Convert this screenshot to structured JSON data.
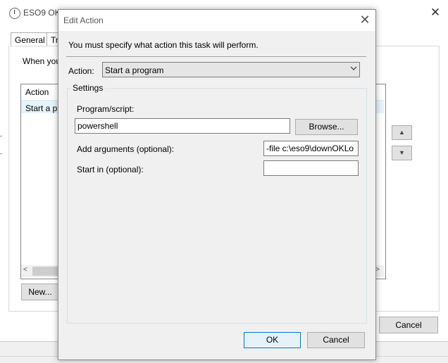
{
  "background_window": {
    "title": "ESO9 OK",
    "tabs": [
      "General",
      "Tr"
    ],
    "when_text": "When you",
    "list": {
      "header": "Action",
      "rows": [
        "Start a pr"
      ]
    },
    "buttons": {
      "new": "New...",
      "cancel": "Cancel"
    }
  },
  "dialog": {
    "title": "Edit Action",
    "instruction": "You must specify what action this task will perform.",
    "action_label": "Action:",
    "action_value": "Start a program",
    "settings_label": "Settings",
    "program_label": "Program/script:",
    "program_value": "powershell",
    "browse_label": "Browse...",
    "args_label": "Add arguments (optional):",
    "args_value": "-file c:\\eso9\\downOKLo",
    "startin_label": "Start in (optional):",
    "startin_value": "",
    "ok_label": "OK",
    "cancel_label": "Cancel"
  },
  "icons": [
    "clock-icon",
    "close-icon",
    "chevron-down-icon",
    "arrow-up-icon",
    "arrow-down-icon",
    "scroll-left-icon",
    "scroll-right-icon"
  ],
  "colors": {
    "accent": "#0078d7",
    "dialog_bg": "#f0f0f0",
    "select_bg": "#e5e5e5"
  }
}
